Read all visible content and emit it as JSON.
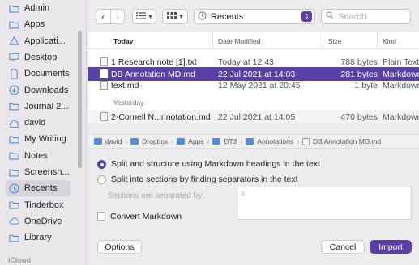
{
  "sidebar": {
    "items": [
      {
        "label": "Admin",
        "icon": "folder-icon"
      },
      {
        "label": "Apps",
        "icon": "folder-icon"
      },
      {
        "label": "Applicati...",
        "icon": "applications-icon"
      },
      {
        "label": "Desktop",
        "icon": "desktop-icon"
      },
      {
        "label": "Documents",
        "icon": "document-icon"
      },
      {
        "label": "Downloads",
        "icon": "download-icon"
      },
      {
        "label": "Journal 2...",
        "icon": "folder-icon"
      },
      {
        "label": "david",
        "icon": "home-icon"
      },
      {
        "label": "My Writing",
        "icon": "folder-icon"
      },
      {
        "label": "Notes",
        "icon": "folder-icon"
      },
      {
        "label": "Screensh...",
        "icon": "folder-icon"
      },
      {
        "label": "Recents",
        "icon": "clock-icon"
      },
      {
        "label": "Tinderbox",
        "icon": "folder-icon"
      },
      {
        "label": "OneDrive",
        "icon": "cloud-icon"
      },
      {
        "label": "Library",
        "icon": "folder-icon"
      }
    ],
    "selected_index": 11,
    "section_label": "iCloud"
  },
  "toolbar": {
    "back": "‹",
    "forward": "›",
    "location": "Recents",
    "search_placeholder": "Search"
  },
  "filelist": {
    "columns": {
      "name": "Today",
      "date": "Date Modified",
      "size": "Size",
      "kind": "Kind"
    },
    "today_rows": [
      {
        "name": "1 Research note [1].txt",
        "date": "Today at 12:43",
        "size": "788 bytes",
        "kind": "Plain Text"
      },
      {
        "name": "DB Annotation MD.md",
        "date": "22 Jul 2021 at 14:03",
        "size": "281 bytes",
        "kind": "Markdown"
      },
      {
        "name": "text.md",
        "date": "12 May 2021 at 20:45",
        "size": "1 byte",
        "kind": "Markdown"
      }
    ],
    "yesterday_label": "Yesterday",
    "yesterday_rows": [
      {
        "name": "2-Cornell N...nnotation.md",
        "date": "22 Jul 2021 at 14:05",
        "size": "470 bytes",
        "kind": "Markdown"
      }
    ]
  },
  "pathbar": {
    "segments": [
      "david",
      "Dropbox",
      "Apps",
      "DT3",
      "Annotations",
      "DB Annotation MD.md"
    ]
  },
  "options": {
    "radio_1": "Split and structure using Markdown headings in the text",
    "radio_2": "Split into sections by finding separators in the text",
    "separator_label": "Sections are separated by:",
    "separator_value": "#",
    "convert_label": "Convert Markdown",
    "options_button": "Options",
    "cancel_button": "Cancel",
    "import_button": "Import"
  },
  "colors": {
    "accent": "#5a3fa6",
    "folder": "#4f8fd8"
  }
}
